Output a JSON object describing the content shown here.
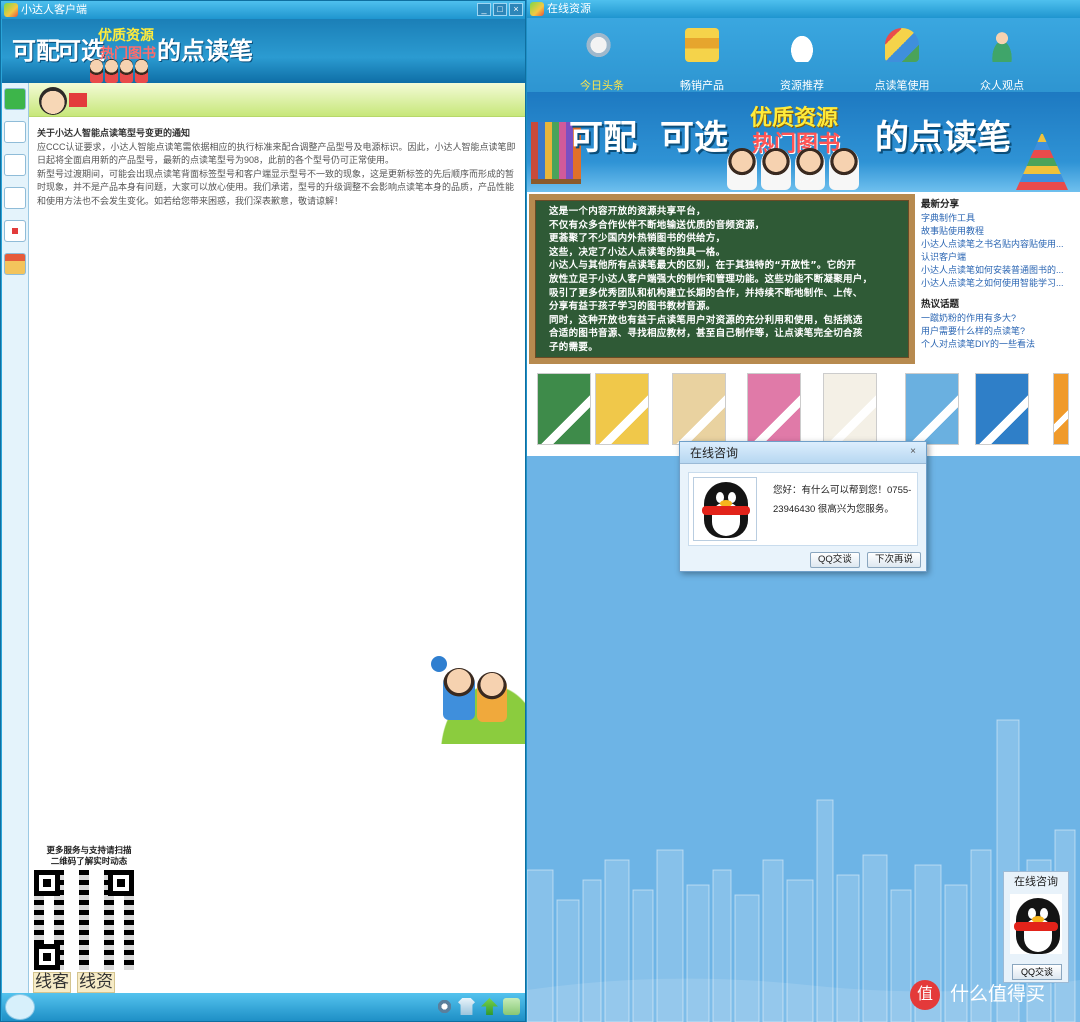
{
  "left_window": {
    "title": "小达人客户端",
    "banner": {
      "text1": "可配",
      "text2": "可选",
      "yellow": "优质资源",
      "red": "热门图书",
      "text3": "的点读笔"
    },
    "notice": {
      "title": "关于小达人智能点读笔型号变更的通知",
      "p1": "应CCC认证要求，小达人智能点读笔需依据相应的执行标准来配合调整产品型号及电源标识。因此，小达人智能点读笔即日起将全面启用新的产品型号，最新的点读笔型号为908，此前的各个型号仍可正常使用。",
      "p2": "新型号过渡期间，可能会出现点读笔背面标签型号和客户端显示型号不一致的现象，这是更新标签的先后顺序而形成的暂时现象，并不是产品本身有问题，大家可以放心使用。我们承诺，型号的升级调整不会影响点读笔本身的品质，产品性能和使用方法也不会发生变化。如若给您带来困惑，我们深表歉意，敬请谅解！"
    },
    "qr": {
      "caption1": "更多服务与支持请扫描",
      "caption2": "二维码了解实时动态",
      "label1": "线客",
      "label2": "线资"
    }
  },
  "right_window": {
    "title": "在线资源",
    "nav": [
      {
        "label": "今日头条",
        "icon": "speaker-icon",
        "active": true
      },
      {
        "label": "畅销产品",
        "icon": "books-icon",
        "active": false
      },
      {
        "label": "资源推荐",
        "icon": "cloud-icon",
        "active": false
      },
      {
        "label": "点读笔使用",
        "icon": "reading-pen-icon",
        "active": false
      },
      {
        "label": "众人观点",
        "icon": "person-icon",
        "active": false
      }
    ],
    "banner": {
      "text1": "可配",
      "text2": "可选",
      "yellow": "优质资源",
      "red": "热门图书",
      "text3": "的点读笔"
    },
    "board_text": [
      "这是一个内容开放的资源共享平台，",
      "不仅有众多合作伙伴不断地输送优质的音频资源，",
      "更荟聚了不少国内外热销图书的供给方，",
      "这些，决定了小达人点读笔的独具一格。",
      "小达人与其他所有点读笔最大的区别，在于其独特的“开放性”。它的开",
      "放性立足于小达人客户端强大的制作和管理功能。这些功能不断凝聚用户，",
      "吸引了更多优秀团队和机构建立长期的合作，并持续不断地制作、上传、",
      "分享有益于孩子学习的图书教材音源。",
      "同时，这种开放也有益于点读笔用户对资源的充分利用和使用，包括挑选",
      "合适的图书音源、寻找相应教材，甚至自己制作等，让点读笔完全切合孩",
      "子的需要。"
    ],
    "latest": {
      "heading": "最新分享",
      "items": [
        "字典制作工具",
        "故事贴使用教程",
        "小达人点读笔之书名贴内容贴使用...",
        "认识客户端",
        "小达人点读笔如何安装普通图书的...",
        "小达人点读笔之如何使用智能学习..."
      ]
    },
    "hot": {
      "heading": "热议话题",
      "items": [
        "一蹴奶粉的作用有多大?",
        "用户需要什么样的点读笔?",
        "个人对点读笔DIY的一些看法"
      ]
    },
    "book_colors": [
      "#3e8b4a",
      "#f0c84a",
      "#e9d2a0",
      "#e07aa8",
      "#f4f0e6",
      "#6ab0e0",
      "#2f7fc8",
      "#f09a2a"
    ]
  },
  "dialog": {
    "title": "在线咨询",
    "close": "×",
    "message": "您好：有什么可以帮到您！0755-23946430 很高兴为您服务。",
    "qq_button": "QQ交谈",
    "later_button": "下次再说"
  },
  "float_qq": {
    "title": "在线咨询",
    "button": "QQ交谈"
  },
  "watermark": {
    "icon": "值",
    "text": "什么值得买"
  },
  "window_buttons": {
    "min": "_",
    "max": "□",
    "close": "×"
  }
}
